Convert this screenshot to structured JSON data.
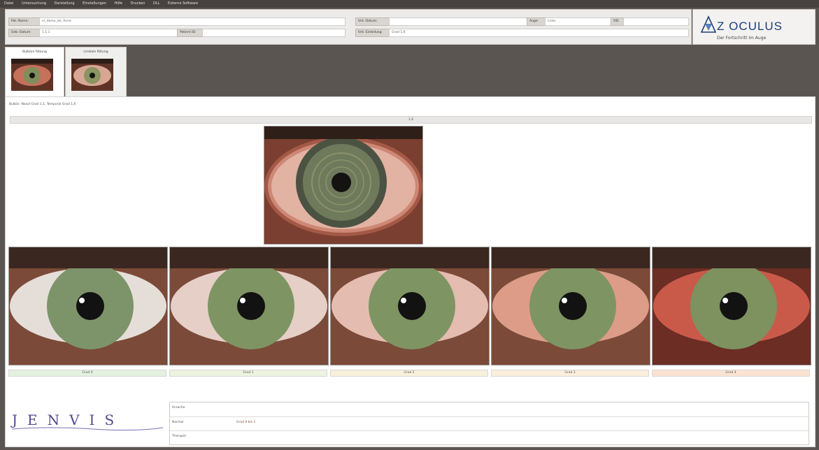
{
  "menu": [
    "Datei",
    "Untersuchung",
    "Darstellung",
    "Einstellungen",
    "Hilfe",
    "Drucken",
    "DLL",
    "Externe Software"
  ],
  "patient": {
    "name_label": "Pat.-Name:",
    "name_value": "vr_demo_de, Anne",
    "dob_label": "Geb.-Datum:",
    "dob_value": "1.1.1",
    "id_label": "Patient ID:",
    "id_value": "",
    "exam_date_label": "Unt.-Datum:",
    "exam_date_value": "",
    "eye_label": "Auge:",
    "eye_value": "Links",
    "extra_label": "OD:",
    "extra_value": "",
    "grading_label": "Unt.-Einteilung:",
    "grading_value": "Grad 1,6"
  },
  "logo": {
    "text": "Z OCULUS",
    "tagline": "Der Fortschritt im Auge"
  },
  "tabs": [
    {
      "label": "Bulbäre Rötung"
    },
    {
      "label": "Limbale Rötung"
    }
  ],
  "summary": "Bulbär: Nasal Grad 1,1, Temporal Grad 1,6",
  "scale_value": "1,6",
  "grades": [
    {
      "label": "Grad 0"
    },
    {
      "label": "Grad 1"
    },
    {
      "label": "Grad 2"
    },
    {
      "label": "Grad 3"
    },
    {
      "label": "Grad 4"
    }
  ],
  "grade_colors": [
    "#e4f1df",
    "#ecf3de",
    "#f7f1dc",
    "#fbeedd",
    "#fbe3d3"
  ],
  "signature": "JENVIS",
  "descriptions": [
    {
      "key": "Ursache",
      "value": ""
    },
    {
      "key": "Normal",
      "value": "Grad 0 bis 1"
    },
    {
      "key": "Therapie",
      "value": ""
    }
  ]
}
